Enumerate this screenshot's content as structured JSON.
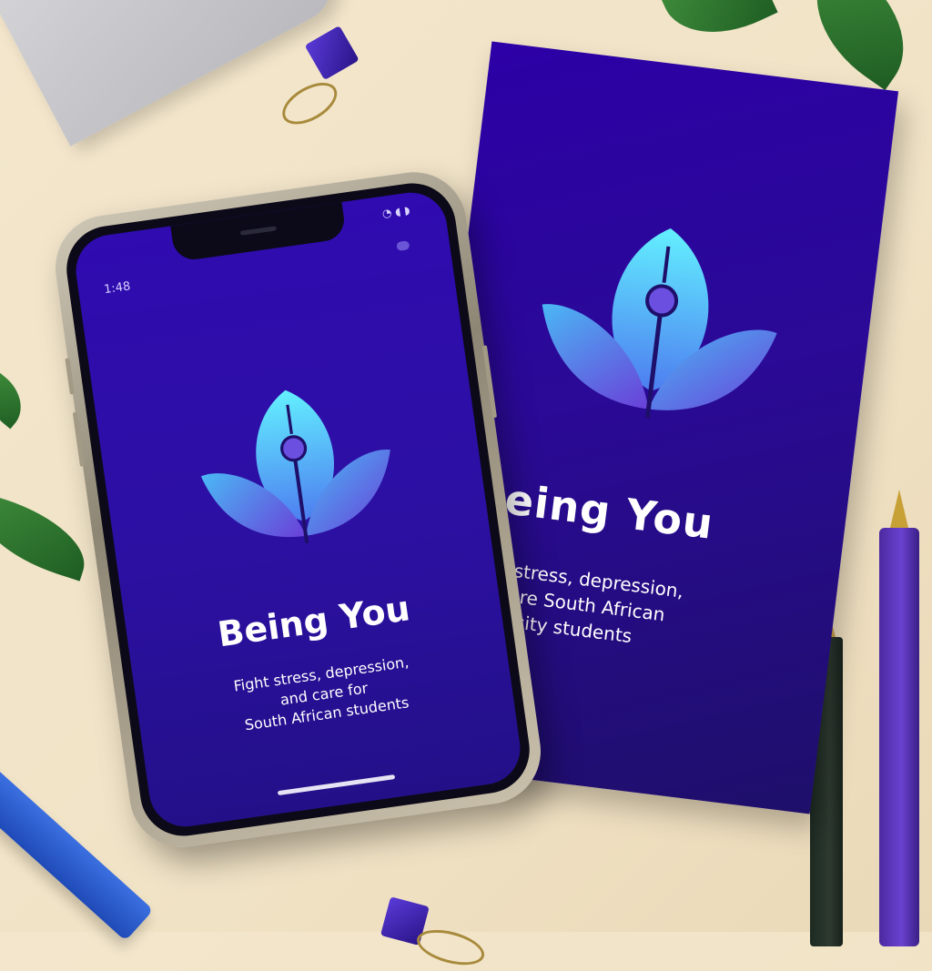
{
  "phone": {
    "status_time": "1:48",
    "status_icons": "◔ ◖ ◗",
    "app_name": "Being You",
    "tagline_line1": "Fight stress, depression,",
    "tagline_line2": "and care for",
    "tagline_line3": "South African students"
  },
  "card": {
    "app_name": "Being You",
    "tagline_line1": "Fight stress, depression,",
    "tagline_line2": "self-care South African",
    "tagline_line3": "university students"
  },
  "colors": {
    "background": "#f3e6cc",
    "brand_purple": "#2c00a6",
    "logo_cyan": "#5fe6ff",
    "logo_violet": "#6a4fe0"
  },
  "icons": {
    "logo": "leaf-sprout-icon"
  }
}
